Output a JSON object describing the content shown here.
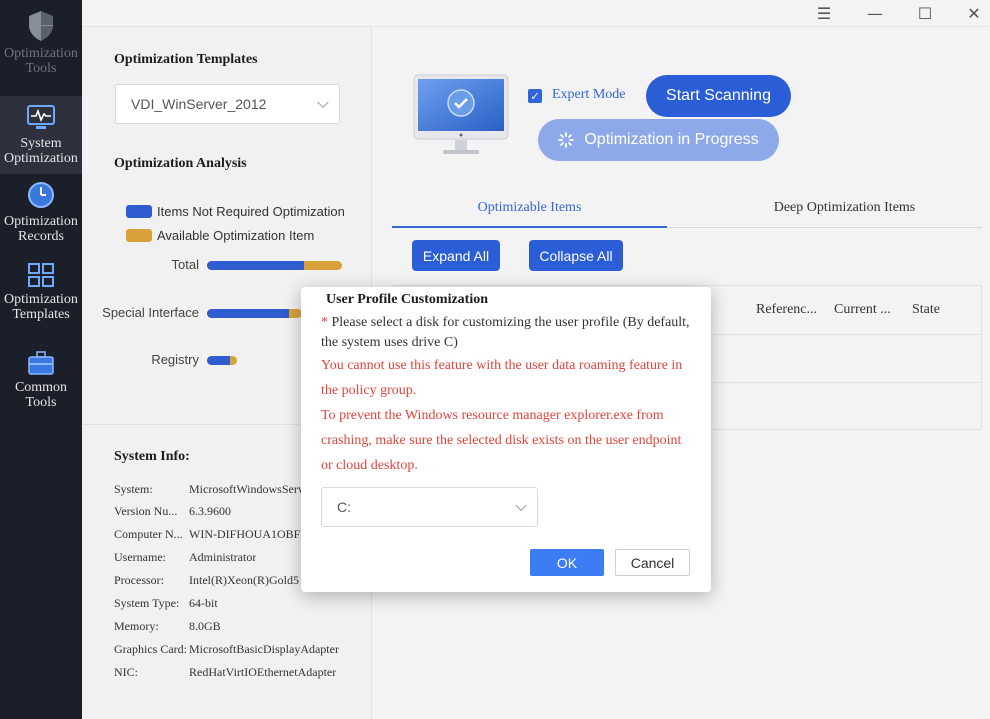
{
  "colors": {
    "sidebar_bg": "#1b1f29",
    "accent": "#2b5ed6",
    "legend_blue": "#2f5ccf",
    "legend_orange": "#d8a13a",
    "warning_red": "#e0443b"
  },
  "sidebar": {
    "items": [
      {
        "label": "Optimization Tools",
        "icon": "shield-icon"
      },
      {
        "label": "System Optimization",
        "icon": "monitor-pulse-icon"
      },
      {
        "label": "Optimization Records",
        "icon": "clock-icon"
      },
      {
        "label": "Optimization Templates",
        "icon": "template-grid-icon"
      },
      {
        "label": "Common Tools",
        "icon": "toolbox-icon"
      }
    ]
  },
  "titlebar": {
    "menu_icon": "☰",
    "minimize_icon": "—",
    "maximize_icon": "☐",
    "close_icon": "✕"
  },
  "left_pane": {
    "templates_title": "Optimization Templates",
    "template_selected": "VDI_WinServer_2012",
    "analysis_title": "Optimization Analysis",
    "legend": [
      {
        "label": "Items Not Required Optimization",
        "color": "#2f5ccf"
      },
      {
        "label": "Available Optimization Item",
        "color": "#d8a13a"
      }
    ],
    "bars": [
      {
        "label": "Total",
        "not_required_fraction": 0.72
      },
      {
        "label": "Special Interface",
        "not_required_fraction": 0.86
      },
      {
        "label": "Registry",
        "not_required_fraction": 0.75
      }
    ],
    "sysinfo_title": "System Info:",
    "sysinfo": [
      {
        "key": "System:",
        "value": "MicrosoftWindowsServ"
      },
      {
        "key": "Version Nu...",
        "value": "6.3.9600"
      },
      {
        "key": "Computer N...",
        "value": "WIN-DIFHOUA1OBF"
      },
      {
        "key": "Username:",
        "value": "Administrator"
      },
      {
        "key": "Processor:",
        "value": "Intel(R)Xeon(R)Gold5"
      },
      {
        "key": "System Type:",
        "value": "64-bit"
      },
      {
        "key": "Memory:",
        "value": "8.0GB"
      },
      {
        "key": "Graphics Card:",
        "value": "MicrosoftBasicDisplayAdapter"
      },
      {
        "key": "NIC:",
        "value": "RedHatVirtIOEthernetAdapter"
      }
    ]
  },
  "right_pane": {
    "expert_mode_label": "Expert Mode",
    "expert_mode_checked": true,
    "start_scan_label": "Start Scanning",
    "in_progress_label": "Optimization in Progress",
    "tabs": [
      {
        "label": "Optimizable Items",
        "active": true
      },
      {
        "label": "Deep Optimization Items",
        "active": false
      }
    ],
    "expand_all_label": "Expand All",
    "collapse_all_label": "Collapse All",
    "table_headers": [
      "Referenc...",
      "Current ...",
      "State"
    ]
  },
  "dialog": {
    "title": "User Profile Customization",
    "required_mark": "*",
    "description": " Please select a disk for customizing the user profile (By default, the system uses drive C)",
    "warning_1": "You cannot use this feature with the user data roaming feature in the policy group.",
    "warning_2": "To prevent the Windows resource manager explorer.exe from crashing, make sure the selected disk exists on the user endpoint or cloud desktop.",
    "disk_selected": "C:",
    "ok_label": "OK",
    "cancel_label": "Cancel"
  }
}
